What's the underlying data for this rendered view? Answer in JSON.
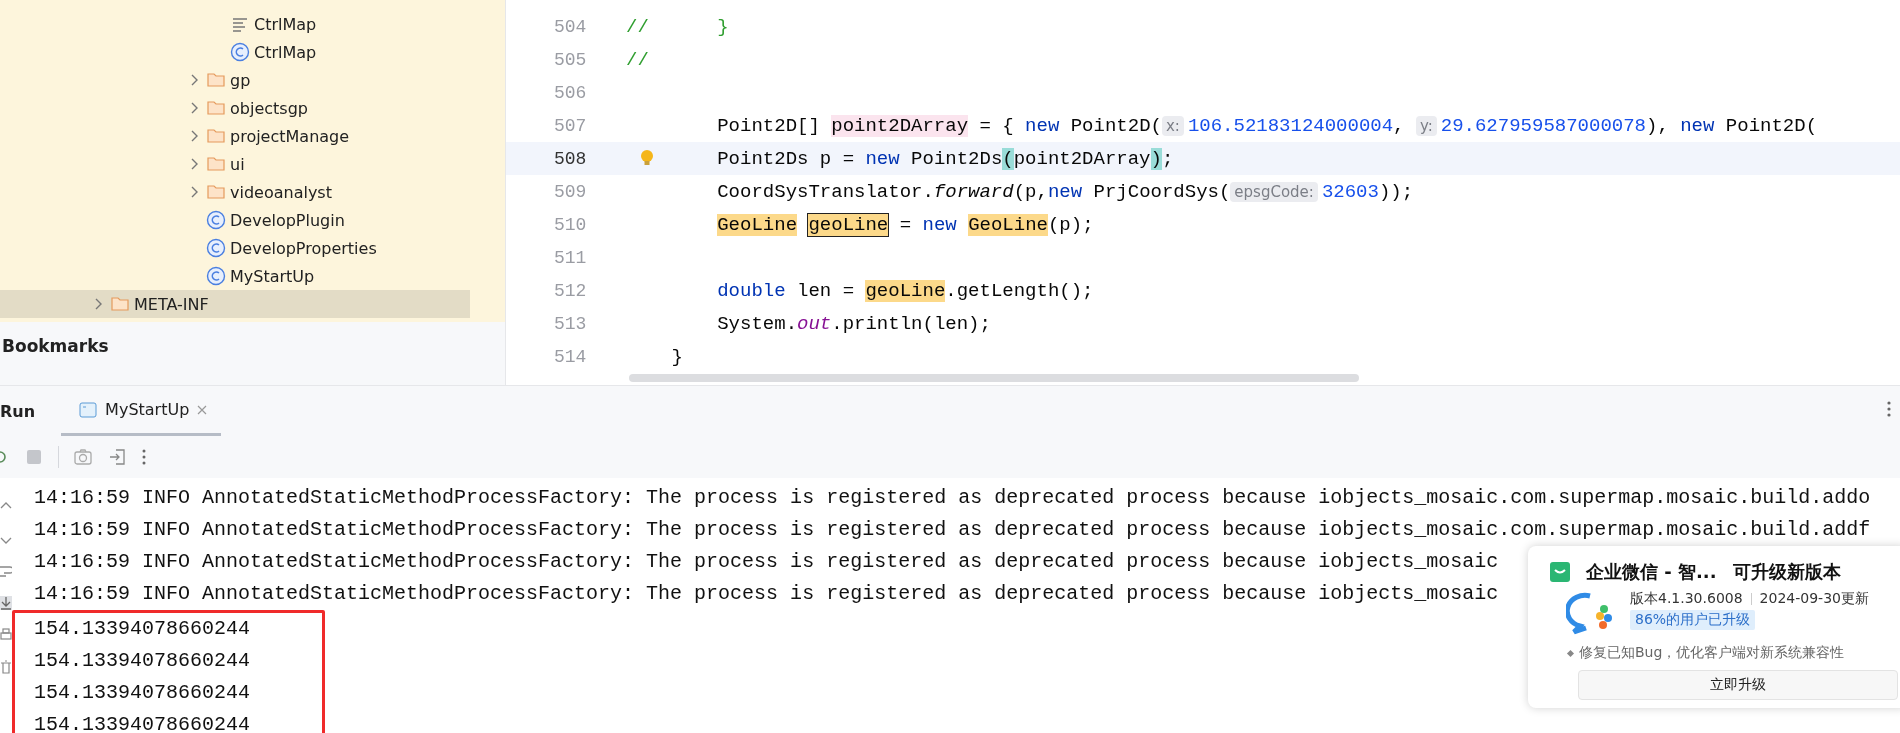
{
  "project_tree": {
    "children": [
      {
        "children": [
          {
            "children": [
              {
                "children": [
                  {
                    "children": [
                      {
                        "children": [
                          {
                            "label": "CtrlMap",
                            "kind": "file",
                            "selected": false
                          },
                          {
                            "label": "CtrlMap",
                            "kind": "class",
                            "selected": false
                          }
                        ]
                      },
                      {
                        "label": "gp",
                        "kind": "folder",
                        "expanded": false,
                        "selected": false
                      },
                      {
                        "label": "objectsgp",
                        "kind": "folder",
                        "expanded": false,
                        "selected": false
                      },
                      {
                        "label": "projectManage",
                        "kind": "folder",
                        "expanded": false,
                        "selected": false
                      },
                      {
                        "label": "ui",
                        "kind": "folder",
                        "expanded": false,
                        "selected": false
                      },
                      {
                        "label": "videoanalyst",
                        "kind": "folder",
                        "expanded": false,
                        "selected": false
                      },
                      {
                        "label": "DevelopPlugin",
                        "kind": "class",
                        "selected": false
                      },
                      {
                        "label": "DevelopProperties",
                        "kind": "class",
                        "selected": false
                      },
                      {
                        "label": "MyStartUp",
                        "kind": "class",
                        "selected": false
                      }
                    ]
                  }
                ]
              }
            ]
          }
        ]
      },
      {
        "label": "META-INF",
        "kind": "folder",
        "expanded": false,
        "selected": true
      }
    ]
  },
  "bookmarks_panel": {
    "title": "Bookmarks"
  },
  "editor": {
    "lines": [
      {
        "number": "504",
        "current": false,
        "bulb": false,
        "segments": [
          {
            "kind": "comment",
            "text": "//      }"
          }
        ]
      },
      {
        "number": "505",
        "current": false,
        "bulb": false,
        "segments": [
          {
            "kind": "comment",
            "text": "//"
          }
        ]
      },
      {
        "number": "506",
        "current": false,
        "bulb": false
      },
      {
        "number": "507",
        "current": false,
        "bulb": false,
        "segments": [
          {
            "kind": "text",
            "text": "        Point2D[] "
          },
          {
            "kind": "var-highlight",
            "text": "point2DArray"
          },
          {
            "kind": "text",
            "text": " = { "
          },
          {
            "kind": "keyword",
            "text": "new"
          },
          {
            "kind": "text",
            "text": " Point2D("
          },
          {
            "kind": "hint",
            "text": "x:"
          },
          {
            "kind": "number",
            "text": "106.52183124000004"
          },
          {
            "kind": "text",
            "text": ", "
          },
          {
            "kind": "hint",
            "text": "y:"
          },
          {
            "kind": "number",
            "text": "29.627959587000078"
          },
          {
            "kind": "text",
            "text": "), "
          },
          {
            "kind": "keyword",
            "text": "new"
          },
          {
            "kind": "text",
            "text": " Point2D("
          }
        ]
      },
      {
        "number": "508",
        "current": true,
        "bulb": true,
        "segments": [
          {
            "kind": "text",
            "text": "        Point2Ds p = "
          },
          {
            "kind": "keyword",
            "text": "new"
          },
          {
            "kind": "text",
            "text": " Point2Ds"
          },
          {
            "kind": "paren-match",
            "text": "("
          },
          {
            "kind": "text",
            "text": "point2DArray"
          },
          {
            "kind": "paren-match",
            "text": ")"
          },
          {
            "kind": "text",
            "text": ";"
          }
        ]
      },
      {
        "number": "509",
        "current": false,
        "bulb": false,
        "segments": [
          {
            "kind": "text",
            "text": "        CoordSysTranslator."
          },
          {
            "kind": "static",
            "text": "forward"
          },
          {
            "kind": "text",
            "text": "(p,"
          },
          {
            "kind": "keyword",
            "text": "new"
          },
          {
            "kind": "text",
            "text": " PrjCoordSys("
          },
          {
            "kind": "hint",
            "text": "epsgCode:"
          },
          {
            "kind": "number",
            "text": "32603"
          },
          {
            "kind": "text",
            "text": "));"
          }
        ]
      },
      {
        "number": "510",
        "current": false,
        "bulb": false,
        "segments": [
          {
            "kind": "usage",
            "text": "        GeoLine"
          },
          {
            "kind": "declaration",
            "text": " geoLine"
          },
          {
            "kind": "text",
            "text": " = "
          },
          {
            "kind": "keyword",
            "text": "new"
          },
          {
            "kind": "usage",
            "text": " GeoLine"
          },
          {
            "kind": "text",
            "text": "(p);"
          }
        ]
      },
      {
        "number": "511",
        "current": false,
        "bulb": false
      },
      {
        "number": "512",
        "current": false,
        "bulb": false,
        "segments": [
          {
            "kind": "keyword",
            "text": "        double"
          },
          {
            "kind": "text",
            "text": " len = "
          },
          {
            "kind": "usage",
            "text": "geoLine"
          },
          {
            "kind": "text",
            "text": ".getLength();"
          }
        ]
      },
      {
        "number": "513",
        "current": false,
        "bulb": false,
        "segments": [
          {
            "kind": "text",
            "text": "        System."
          },
          {
            "kind": "field",
            "text": "out"
          },
          {
            "kind": "text",
            "text": ".println(len);"
          }
        ]
      },
      {
        "number": "514",
        "current": false,
        "bulb": false,
        "segments": [
          {
            "kind": "text",
            "text": "    }"
          }
        ]
      }
    ]
  },
  "run_panel": {
    "title": "Run",
    "tabs": [
      {
        "label": "MyStartUp",
        "selected": true
      }
    ],
    "console": {
      "lines": [
        {
          "text": "14:16:59 INFO AnnotatedStaticMethodProcessFactory: The process is registered as deprecated process because iobjects_mosaic.com.supermap.mosaic.build.addo",
          "boxed": false
        },
        {
          "text": "14:16:59 INFO AnnotatedStaticMethodProcessFactory: The process is registered as deprecated process because iobjects_mosaic.com.supermap.mosaic.build.addf",
          "boxed": false
        },
        {
          "text": "14:16:59 INFO AnnotatedStaticMethodProcessFactory: The process is registered as deprecated process because iobjects_mosaic",
          "boxed": false
        },
        {
          "text": "14:16:59 INFO AnnotatedStaticMethodProcessFactory: The process is registered as deprecated process because iobjects_mosaic",
          "boxed": false
        },
        {
          "text": "154.13394078660244",
          "boxed": true
        },
        {
          "text": "154.13394078660244",
          "boxed": true
        },
        {
          "text": "154.13394078660244",
          "boxed": true
        },
        {
          "text": "154.13394078660244",
          "boxed": true
        }
      ]
    }
  },
  "notification": {
    "app_name": "企业微信 - 智...",
    "headline": "可升级新版本",
    "version": "版本4.1.30.6008",
    "date": "2024-09-30更新",
    "badge": "86%的用户已升级",
    "notes": [
      "修复已知Bug，优化客户端对新系统兼容性"
    ],
    "button": "立即升级"
  }
}
